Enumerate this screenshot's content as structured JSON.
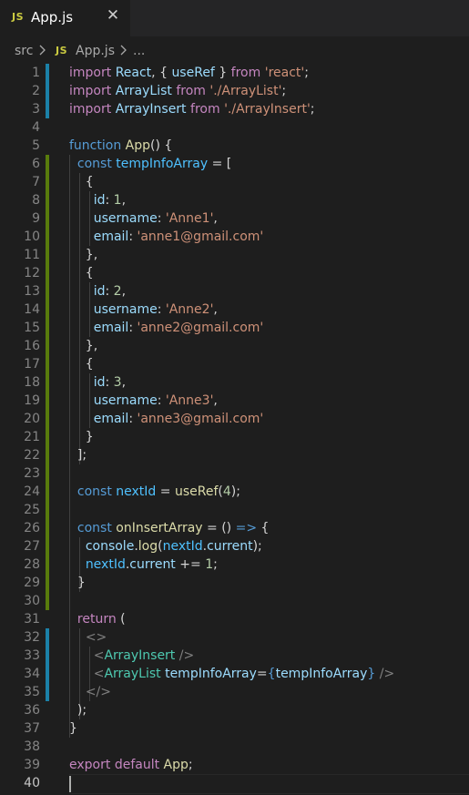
{
  "tab": {
    "badge": "JS",
    "title": "App.js",
    "close_glyph": "✕"
  },
  "breadcrumb": {
    "folder": "src",
    "badge": "JS",
    "file": "App.js",
    "ellipsis": "..."
  },
  "editor": {
    "lines": [
      [
        [
          "kw2",
          "import"
        ],
        [
          "plain",
          " "
        ],
        [
          "var",
          "React"
        ],
        [
          "plain",
          ", { "
        ],
        [
          "var",
          "useRef"
        ],
        [
          "plain",
          " } "
        ],
        [
          "kw2",
          "from"
        ],
        [
          "plain",
          " "
        ],
        [
          "str",
          "'react'"
        ],
        [
          "plain",
          ";"
        ]
      ],
      [
        [
          "kw2",
          "import"
        ],
        [
          "plain",
          " "
        ],
        [
          "var",
          "ArrayList"
        ],
        [
          "plain",
          " "
        ],
        [
          "kw2",
          "from"
        ],
        [
          "plain",
          " "
        ],
        [
          "str",
          "'./ArrayList'"
        ],
        [
          "plain",
          ";"
        ]
      ],
      [
        [
          "kw2",
          "import"
        ],
        [
          "plain",
          " "
        ],
        [
          "var",
          "ArrayInsert"
        ],
        [
          "plain",
          " "
        ],
        [
          "kw2",
          "from"
        ],
        [
          "plain",
          " "
        ],
        [
          "str",
          "'./ArrayInsert'"
        ],
        [
          "plain",
          ";"
        ]
      ],
      [],
      [
        [
          "kw",
          "function"
        ],
        [
          "plain",
          " "
        ],
        [
          "fn",
          "App"
        ],
        [
          "plain",
          "() {"
        ]
      ],
      [
        [
          "plain",
          "  "
        ],
        [
          "kw",
          "const"
        ],
        [
          "plain",
          " "
        ],
        [
          "const",
          "tempInfoArray"
        ],
        [
          "plain",
          " = ["
        ]
      ],
      [
        [
          "plain",
          "    {"
        ]
      ],
      [
        [
          "plain",
          "      "
        ],
        [
          "var",
          "id"
        ],
        [
          "plain",
          ": "
        ],
        [
          "num",
          "1"
        ],
        [
          "plain",
          ","
        ]
      ],
      [
        [
          "plain",
          "      "
        ],
        [
          "var",
          "username"
        ],
        [
          "plain",
          ": "
        ],
        [
          "str",
          "'Anne1'"
        ],
        [
          "plain",
          ","
        ]
      ],
      [
        [
          "plain",
          "      "
        ],
        [
          "var",
          "email"
        ],
        [
          "plain",
          ": "
        ],
        [
          "str",
          "'anne1@gmail.com'"
        ]
      ],
      [
        [
          "plain",
          "    },"
        ]
      ],
      [
        [
          "plain",
          "    {"
        ]
      ],
      [
        [
          "plain",
          "      "
        ],
        [
          "var",
          "id"
        ],
        [
          "plain",
          ": "
        ],
        [
          "num",
          "2"
        ],
        [
          "plain",
          ","
        ]
      ],
      [
        [
          "plain",
          "      "
        ],
        [
          "var",
          "username"
        ],
        [
          "plain",
          ": "
        ],
        [
          "str",
          "'Anne2'"
        ],
        [
          "plain",
          ","
        ]
      ],
      [
        [
          "plain",
          "      "
        ],
        [
          "var",
          "email"
        ],
        [
          "plain",
          ": "
        ],
        [
          "str",
          "'anne2@gmail.com'"
        ]
      ],
      [
        [
          "plain",
          "    },"
        ]
      ],
      [
        [
          "plain",
          "    {"
        ]
      ],
      [
        [
          "plain",
          "      "
        ],
        [
          "var",
          "id"
        ],
        [
          "plain",
          ": "
        ],
        [
          "num",
          "3"
        ],
        [
          "plain",
          ","
        ]
      ],
      [
        [
          "plain",
          "      "
        ],
        [
          "var",
          "username"
        ],
        [
          "plain",
          ": "
        ],
        [
          "str",
          "'Anne3'"
        ],
        [
          "plain",
          ","
        ]
      ],
      [
        [
          "plain",
          "      "
        ],
        [
          "var",
          "email"
        ],
        [
          "plain",
          ": "
        ],
        [
          "str",
          "'anne3@gmail.com'"
        ]
      ],
      [
        [
          "plain",
          "    }"
        ]
      ],
      [
        [
          "plain",
          "  ];"
        ]
      ],
      [],
      [
        [
          "plain",
          "  "
        ],
        [
          "kw",
          "const"
        ],
        [
          "plain",
          " "
        ],
        [
          "const",
          "nextId"
        ],
        [
          "plain",
          " = "
        ],
        [
          "fn",
          "useRef"
        ],
        [
          "plain",
          "("
        ],
        [
          "num",
          "4"
        ],
        [
          "plain",
          ");"
        ]
      ],
      [],
      [
        [
          "plain",
          "  "
        ],
        [
          "kw",
          "const"
        ],
        [
          "plain",
          " "
        ],
        [
          "fn",
          "onInsertArray"
        ],
        [
          "plain",
          " = () "
        ],
        [
          "kw",
          "=>"
        ],
        [
          "plain",
          " {"
        ]
      ],
      [
        [
          "plain",
          "    "
        ],
        [
          "var",
          "console"
        ],
        [
          "plain",
          "."
        ],
        [
          "fn",
          "log"
        ],
        [
          "plain",
          "("
        ],
        [
          "const",
          "nextId"
        ],
        [
          "plain",
          "."
        ],
        [
          "var",
          "current"
        ],
        [
          "plain",
          ");"
        ]
      ],
      [
        [
          "plain",
          "    "
        ],
        [
          "const",
          "nextId"
        ],
        [
          "plain",
          "."
        ],
        [
          "var",
          "current"
        ],
        [
          "plain",
          " += "
        ],
        [
          "num",
          "1"
        ],
        [
          "plain",
          ";"
        ]
      ],
      [
        [
          "plain",
          "  }"
        ]
      ],
      [],
      [
        [
          "plain",
          "  "
        ],
        [
          "kw2",
          "return"
        ],
        [
          "plain",
          " ("
        ]
      ],
      [
        [
          "plain",
          "    "
        ],
        [
          "punc",
          "<>"
        ]
      ],
      [
        [
          "plain",
          "      "
        ],
        [
          "punc",
          "<"
        ],
        [
          "tag",
          "ArrayInsert"
        ],
        [
          "plain",
          " "
        ],
        [
          "punc",
          "/>"
        ]
      ],
      [
        [
          "plain",
          "      "
        ],
        [
          "punc",
          "<"
        ],
        [
          "tag",
          "ArrayList"
        ],
        [
          "plain",
          " "
        ],
        [
          "var",
          "tempInfoArray"
        ],
        [
          "plain",
          "="
        ],
        [
          "kw",
          "{"
        ],
        [
          "var",
          "tempInfoArray"
        ],
        [
          "kw",
          "}"
        ],
        [
          "plain",
          " "
        ],
        [
          "punc",
          "/>"
        ]
      ],
      [
        [
          "plain",
          "    "
        ],
        [
          "punc",
          "</>"
        ]
      ],
      [
        [
          "plain",
          "  );"
        ]
      ],
      [
        [
          "plain",
          "}"
        ]
      ],
      [],
      [
        [
          "kw2",
          "export"
        ],
        [
          "plain",
          " "
        ],
        [
          "kw2",
          "default"
        ],
        [
          "plain",
          " "
        ],
        [
          "fn",
          "App"
        ],
        [
          "plain",
          ";"
        ]
      ],
      []
    ],
    "line_numbers": [
      "1",
      "2",
      "3",
      "4",
      "5",
      "6",
      "7",
      "8",
      "9",
      "10",
      "11",
      "12",
      "13",
      "14",
      "15",
      "16",
      "17",
      "18",
      "19",
      "20",
      "21",
      "22",
      "23",
      "24",
      "25",
      "26",
      "27",
      "28",
      "29",
      "30",
      "31",
      "32",
      "33",
      "34",
      "35",
      "36",
      "37",
      "38",
      "39",
      "40"
    ]
  },
  "colors": {
    "modified_bar": "#1b81a8",
    "added_bar": "#587c0c"
  }
}
